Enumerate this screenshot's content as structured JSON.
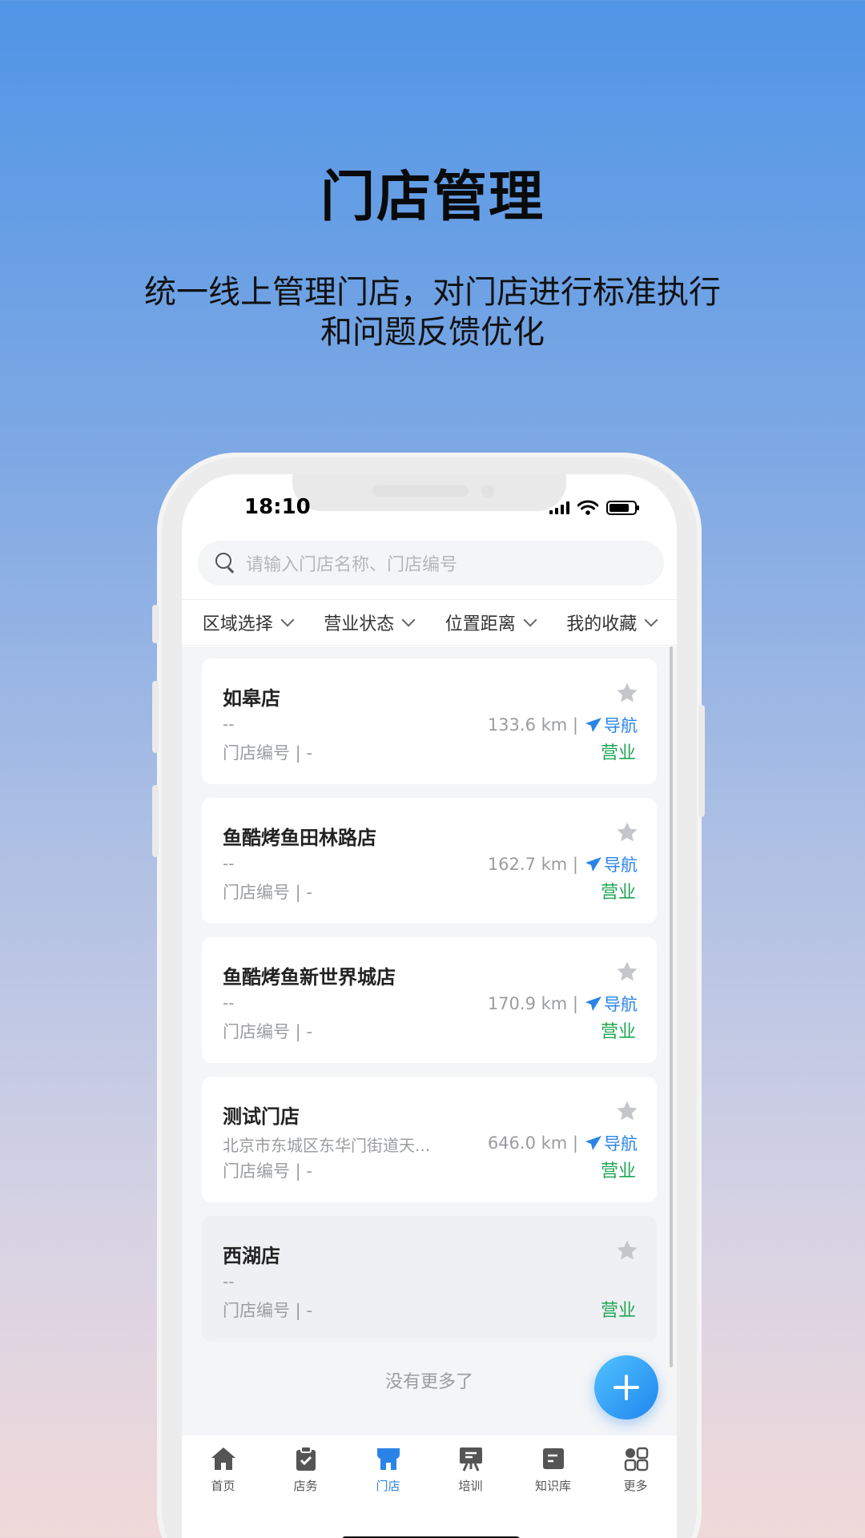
{
  "hero": {
    "title": "门店管理",
    "subtitle_line1": "统一线上管理门店，对门店进行标准执行",
    "subtitle_line2": "和问题反馈优化"
  },
  "status_bar": {
    "time": "18:10"
  },
  "search": {
    "placeholder": "请输入门店名称、门店编号"
  },
  "filters": [
    "区域选择",
    "营业状态",
    "位置距离",
    "我的收藏"
  ],
  "stores": [
    {
      "name": "如皋店",
      "address": "--",
      "code": "门店编号 | -",
      "distance": "133.6 km",
      "nav": "导航",
      "status": "营业"
    },
    {
      "name": "鱼酷烤鱼田林路店",
      "address": "--",
      "code": "门店编号 | -",
      "distance": "162.7 km",
      "nav": "导航",
      "status": "营业"
    },
    {
      "name": "鱼酷烤鱼新世界城店",
      "address": "--",
      "code": "门店编号 | -",
      "distance": "170.9 km",
      "nav": "导航",
      "status": "营业"
    },
    {
      "name": "测试门店",
      "address": "北京市东城区东华门街道天...",
      "code": "门店编号 | -",
      "distance": "646.0 km",
      "nav": "导航",
      "status": "营业"
    },
    {
      "name": "西湖店",
      "address": "--",
      "code": "门店编号 | -",
      "status": "营业"
    }
  ],
  "list_footer": "没有更多了",
  "tabs": [
    {
      "label": "首页",
      "icon": "home-icon"
    },
    {
      "label": "店务",
      "icon": "clipboard-icon"
    },
    {
      "label": "门店",
      "icon": "store-icon",
      "active": true
    },
    {
      "label": "培训",
      "icon": "training-icon"
    },
    {
      "label": "知识库",
      "icon": "knowledge-icon"
    },
    {
      "label": "更多",
      "icon": "grid-icon"
    }
  ],
  "colors": {
    "accent": "#2a84e8",
    "status_open": "#1fa654"
  }
}
